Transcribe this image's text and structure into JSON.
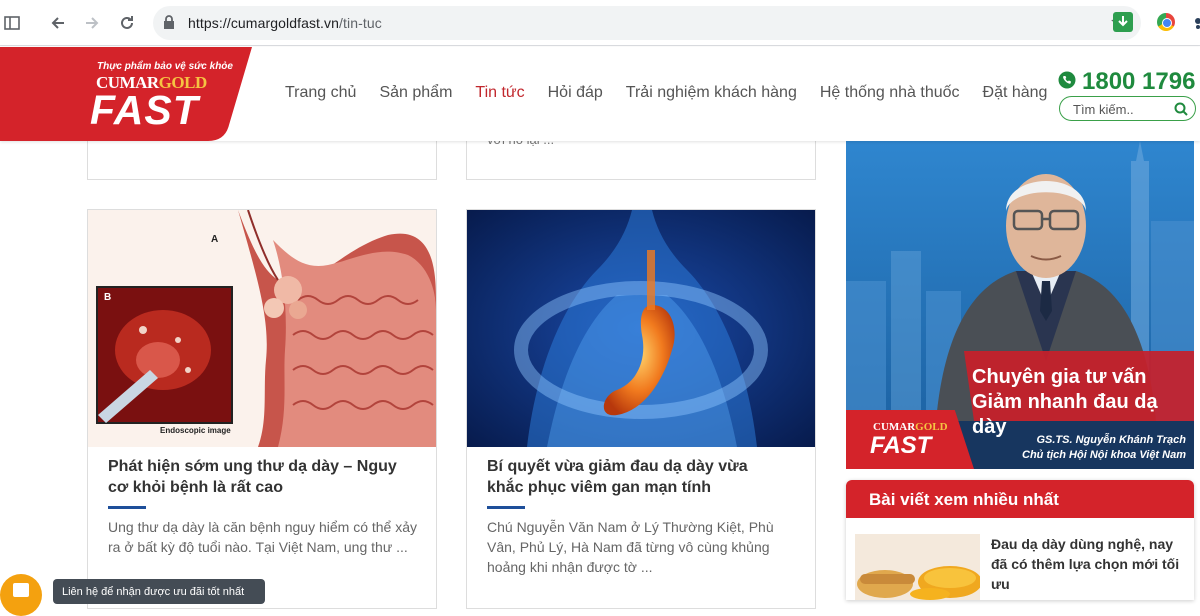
{
  "browser": {
    "url_domain": "https://cumargoldfast.vn",
    "url_path": "/tin-tuc"
  },
  "header": {
    "logo": {
      "tagline": "Thực phẩm bảo vệ sức khỏe",
      "brand_a": "CUMAR",
      "brand_b": "GOLD",
      "brand_c": "FAST"
    },
    "nav": [
      "Trang chủ",
      "Sản phẩm",
      "Tin tức",
      "Hỏi đáp",
      "Trải nghiệm khách hàng",
      "Hệ thống nhà thuốc",
      "Đặt hàng"
    ],
    "active_nav": "Tin tức",
    "hotline": "1800 1796",
    "search_placeholder": "Tìm kiếm.."
  },
  "articles_top": [
    {
      "excerpt": ""
    },
    {
      "excerpt": "với nó lại ..."
    }
  ],
  "articles": [
    {
      "title": "Phát hiện sớm ung thư dạ dày – Nguy cơ khỏi bệnh là rất cao",
      "excerpt": "Ung thư dạ dày là căn bệnh nguy hiểm có thể xảy ra ở bất kỳ độ tuổi nào. Tại Việt Nam, ung thư ...",
      "image_label_a": "A",
      "image_label_b": "B",
      "image_caption": "Endoscopic image"
    },
    {
      "title": "Bí quyết vừa giảm đau dạ dày vừa khắc phục viêm gan mạn tính",
      "excerpt": "Chú Nguyễn Văn Nam ở Lý Thường Kiệt, Phù Vân, Phủ Lý, Hà Nam đã từng vô cùng khủng hoảng khi nhận được tờ ..."
    }
  ],
  "sidebar": {
    "banner": {
      "headline_1": "Chuyên gia tư vấn",
      "headline_2": "Giảm nhanh đau dạ dày",
      "brand_a": "CUMAR",
      "brand_b": "GOLD",
      "brand_c": "FAST",
      "person_name": "GS.TS. Nguyễn Khánh Trạch",
      "person_title": "Chủ tịch Hội Nội khoa Việt Nam"
    },
    "popular": {
      "heading": "Bài viết xem nhiều nhất",
      "items": [
        {
          "title": "Đau dạ dày dùng nghệ, nay đã có thêm lựa chọn mới tối ưu"
        }
      ]
    }
  },
  "floating": {
    "tooltip": "Liên hệ để nhận được ưu đãi tốt nhất"
  },
  "colors": {
    "brand_red": "#d4232a",
    "hotline_green": "#1f8a3e",
    "accent_blue": "#1e4f9a",
    "chat_orange": "#f4a10f"
  }
}
